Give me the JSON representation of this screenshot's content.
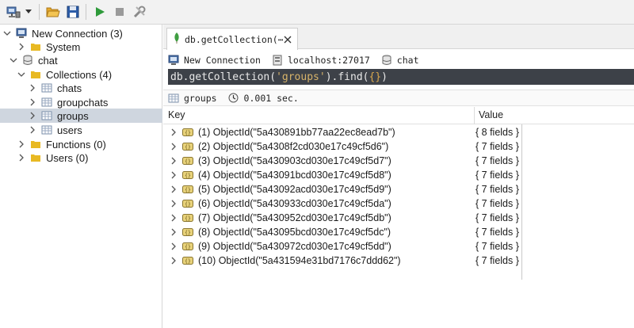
{
  "colors": {
    "selected_row": "#cfd6df",
    "query_bg": "#3d4148",
    "query_string": "#d7b36a",
    "run_green": "#2e9a3a",
    "folder_yellow": "#e8b923"
  },
  "toolbar": {
    "buttons": [
      {
        "name": "connect",
        "icon": "connection-icon"
      },
      {
        "name": "open",
        "icon": "folder-open-icon"
      },
      {
        "name": "save",
        "icon": "save-icon"
      },
      {
        "name": "run",
        "icon": "play-icon"
      },
      {
        "name": "stop",
        "icon": "stop-icon"
      },
      {
        "name": "format",
        "icon": "tools-icon"
      }
    ]
  },
  "sidebar": {
    "connection": {
      "label": "New Connection (3)"
    },
    "system": {
      "label": "System"
    },
    "db": {
      "label": "chat"
    },
    "collections": {
      "label": "Collections (4)"
    },
    "collection_items": [
      {
        "label": "chats"
      },
      {
        "label": "groupchats"
      },
      {
        "label": "groups"
      },
      {
        "label": "users"
      }
    ],
    "functions": {
      "label": "Functions (0)"
    },
    "users": {
      "label": "Users (0)"
    }
  },
  "tab": {
    "label": "db.getCollection(⋯"
  },
  "breadcrumb": {
    "connection": "New Connection",
    "server": "localhost:27017",
    "database": "chat"
  },
  "query": {
    "prefix": "db.getCollection(",
    "arg": "'groups'",
    "middle": ").find(",
    "braces": "{}",
    "suffix": ")"
  },
  "status": {
    "collection": "groups",
    "time": "0.001 sec."
  },
  "results": {
    "key_header": "Key",
    "value_header": "Value",
    "rows": [
      {
        "key": "(1) ObjectId(\"5a430891bb77aa22ec8ead7b\")",
        "value": "{ 8 fields }"
      },
      {
        "key": "(2) ObjectId(\"5a4308f2cd030e17c49cf5d6\")",
        "value": "{ 7 fields }"
      },
      {
        "key": "(3) ObjectId(\"5a430903cd030e17c49cf5d7\")",
        "value": "{ 7 fields }"
      },
      {
        "key": "(4) ObjectId(\"5a43091bcd030e17c49cf5d8\")",
        "value": "{ 7 fields }"
      },
      {
        "key": "(5) ObjectId(\"5a43092acd030e17c49cf5d9\")",
        "value": "{ 7 fields }"
      },
      {
        "key": "(6) ObjectId(\"5a430933cd030e17c49cf5da\")",
        "value": "{ 7 fields }"
      },
      {
        "key": "(7) ObjectId(\"5a430952cd030e17c49cf5db\")",
        "value": "{ 7 fields }"
      },
      {
        "key": "(8) ObjectId(\"5a43095bcd030e17c49cf5dc\")",
        "value": "{ 7 fields }"
      },
      {
        "key": "(9) ObjectId(\"5a430972cd030e17c49cf5dd\")",
        "value": "{ 7 fields }"
      },
      {
        "key": "(10) ObjectId(\"5a431594e31bd7176c7ddd62\")",
        "value": "{ 7 fields }"
      }
    ]
  }
}
